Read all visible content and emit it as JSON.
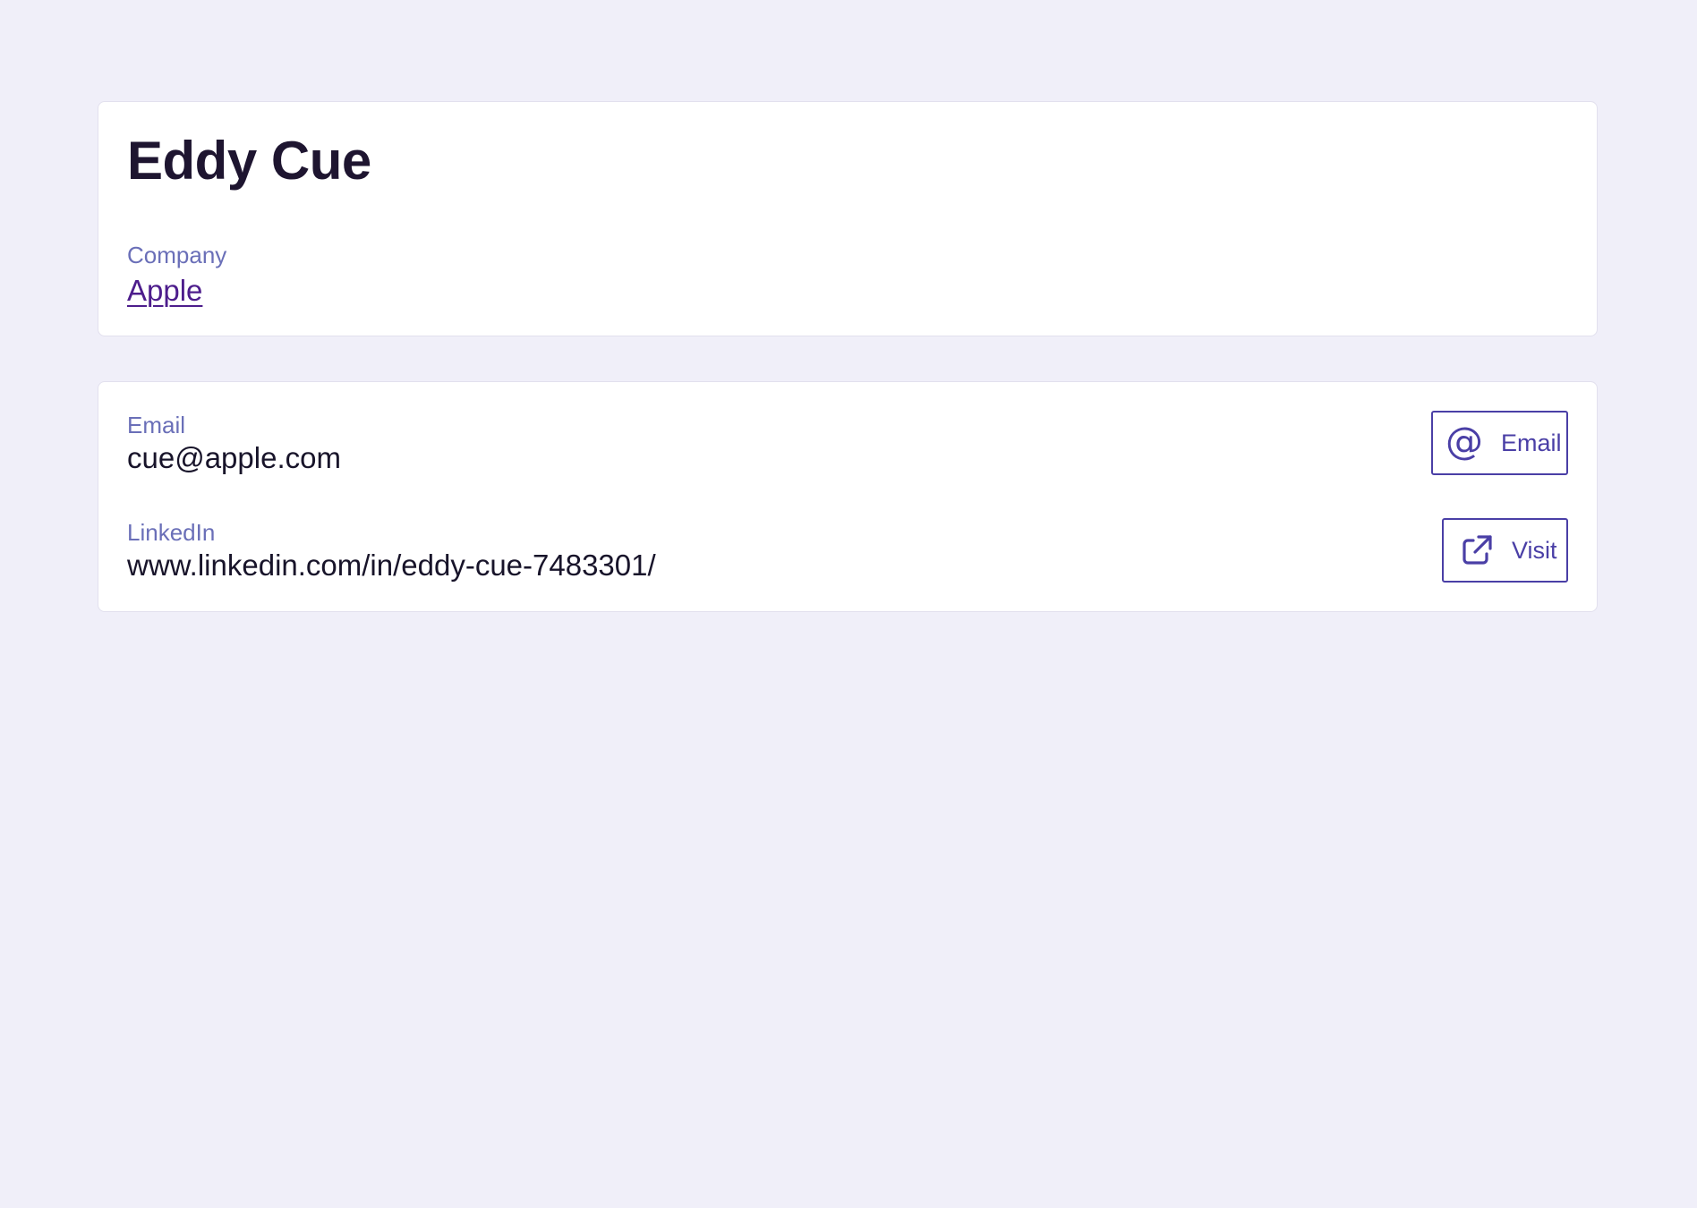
{
  "person": {
    "name": "Eddy Cue"
  },
  "company": {
    "label": "Company",
    "value": "Apple"
  },
  "contact": {
    "email": {
      "label": "Email",
      "value": "cue@apple.com",
      "button_label": "Email",
      "button_icon": "at-icon"
    },
    "linkedin": {
      "label": "LinkedIn",
      "value": "www.linkedin.com/in/eddy-cue-7483301/",
      "button_label": "Visit",
      "button_icon": "external-link-icon"
    }
  },
  "colors": {
    "background": "#f0eff9",
    "card": "#ffffff",
    "label": "#6a6fb8",
    "link": "#4d1d8c",
    "accent": "#4a3fa6",
    "heading": "#1e1530"
  }
}
